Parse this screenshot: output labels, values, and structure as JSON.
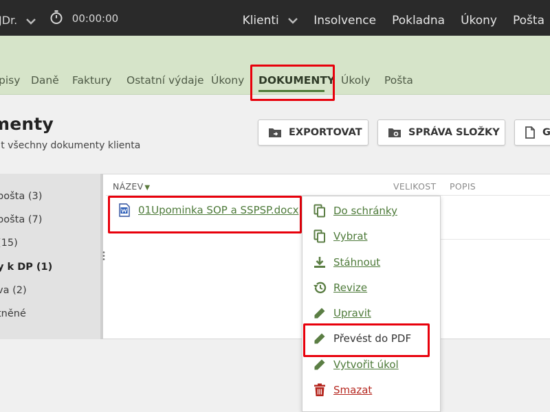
{
  "topbar": {
    "user": "JDr.",
    "timer": "00:00:00",
    "nav": [
      "Klienti",
      "Insolvence",
      "Pokladna",
      "Úkony",
      "Pošta"
    ]
  },
  "tabs": [
    "pisy",
    "Daně",
    "Faktury",
    "Ostatní výdaje",
    "Úkony",
    "DOKUMENTY",
    "Úkoly",
    "Pošta"
  ],
  "page": {
    "title": "umenty",
    "subtitle": "zit všechny dokumenty klienta"
  },
  "buttons": {
    "export": "EXPORTOVAT",
    "folder": "SPRÁVA SLOŽKY",
    "gen": "G"
  },
  "sidebar": {
    "items": [
      {
        "label": "pošta",
        "count": "(3)"
      },
      {
        "label": "pošta",
        "count": "(7)"
      },
      {
        "label": "",
        "count": "(15)"
      },
      {
        "label": "y k DP",
        "count": "(1)"
      },
      {
        "label": "va",
        "count": "(2)"
      },
      {
        "label": "tněné",
        "count": ""
      }
    ]
  },
  "table": {
    "columns": {
      "name": "NÁZEV",
      "size": "VELIKOST",
      "desc": "POPIS"
    },
    "file": "01Upominka SOP a SSPSP.docx"
  },
  "menu": {
    "items": [
      {
        "label": "Do schránky",
        "icon": "copy-icon"
      },
      {
        "label": "Vybrat",
        "icon": "copy-icon"
      },
      {
        "label": "Stáhnout",
        "icon": "download-icon"
      },
      {
        "label": "Revize",
        "icon": "history-icon"
      },
      {
        "label": "Upravit",
        "icon": "pencil-icon"
      },
      {
        "label": "Převést do PDF",
        "icon": "pencil-icon"
      },
      {
        "label": "Vytvořit úkol",
        "icon": "pencil-icon"
      },
      {
        "label": "Smazat",
        "icon": "trash-icon"
      }
    ]
  },
  "colors": {
    "accent": "#4d7a39",
    "topbar": "#2a2a2a",
    "band": "#d6e4c9",
    "highlight": "#e8000b",
    "danger": "#b5261e"
  }
}
